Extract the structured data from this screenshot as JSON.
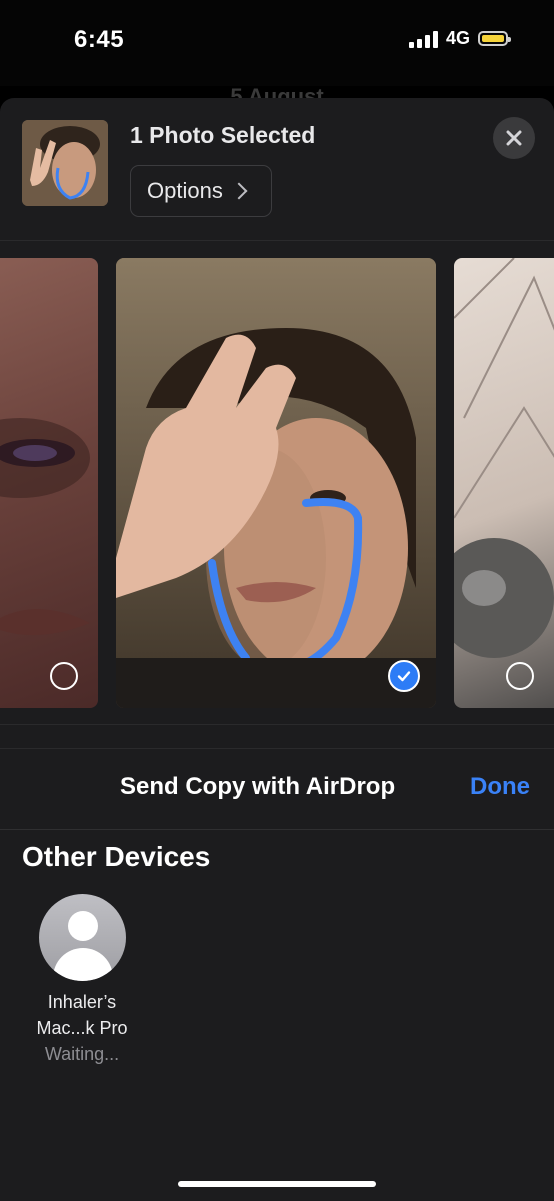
{
  "status_bar": {
    "time": "6:45",
    "network": "4G",
    "battery_color": "#f5d33a"
  },
  "background": {
    "date_title": "5 August"
  },
  "share_sheet": {
    "selection_title": "1 Photo Selected",
    "options_label": "Options",
    "close_icon": "close-icon",
    "photos": [
      {
        "position": "left",
        "selected": false
      },
      {
        "position": "center",
        "selected": true
      },
      {
        "position": "right",
        "selected": false
      }
    ]
  },
  "airdrop": {
    "title": "Send Copy with AirDrop",
    "done_label": "Done",
    "accent_color": "#3a82f7",
    "section_title": "Other Devices",
    "devices": [
      {
        "name_line1": "Inhaler’s",
        "name_line2": "Mac...k Pro",
        "status": "Waiting..."
      }
    ]
  }
}
